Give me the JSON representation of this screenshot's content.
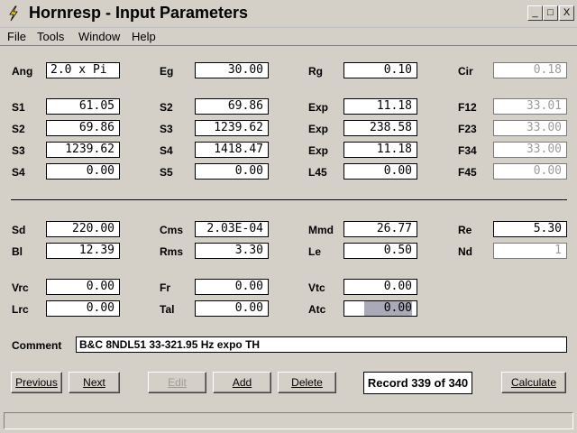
{
  "window": {
    "title": "Hornresp - Input Parameters",
    "btn_min": "_",
    "btn_max": "□",
    "btn_close": "X"
  },
  "menu": [
    "File",
    "Tools",
    "Window",
    "Help"
  ],
  "rows": [
    {
      "cells": [
        {
          "label": "Ang",
          "value": "2.0 x Pi",
          "align": "left"
        },
        {
          "label": "Eg",
          "value": "30.00"
        },
        {
          "label": "Rg",
          "value": "0.10"
        },
        {
          "label": "Cir",
          "value": "0.18",
          "dim": true
        }
      ]
    },
    {
      "cells": [
        {
          "label": "S1",
          "value": "61.05"
        },
        {
          "label": "S2",
          "value": "69.86"
        },
        {
          "label": "Exp",
          "value": "11.18"
        },
        {
          "label": "F12",
          "value": "33.01",
          "dim": true
        }
      ]
    },
    {
      "cells": [
        {
          "label": "S2",
          "value": "69.86"
        },
        {
          "label": "S3",
          "value": "1239.62"
        },
        {
          "label": "Exp",
          "value": "238.58"
        },
        {
          "label": "F23",
          "value": "33.00",
          "dim": true
        }
      ]
    },
    {
      "cells": [
        {
          "label": "S3",
          "value": "1239.62"
        },
        {
          "label": "S4",
          "value": "1418.47"
        },
        {
          "label": "Exp",
          "value": "11.18"
        },
        {
          "label": "F34",
          "value": "33.00",
          "dim": true
        }
      ]
    },
    {
      "cells": [
        {
          "label": "S4",
          "value": "0.00"
        },
        {
          "label": "S5",
          "value": "0.00"
        },
        {
          "label": "L45",
          "value": "0.00"
        },
        {
          "label": "F45",
          "value": "0.00",
          "dim": true
        }
      ]
    },
    {
      "cells": [
        {
          "label": "Sd",
          "value": "220.00"
        },
        {
          "label": "Cms",
          "value": "2.03E-04"
        },
        {
          "label": "Mmd",
          "value": "26.77"
        },
        {
          "label": "Re",
          "value": "5.30"
        }
      ]
    },
    {
      "cells": [
        {
          "label": "Bl",
          "value": "12.39"
        },
        {
          "label": "Rms",
          "value": "3.30"
        },
        {
          "label": "Le",
          "value": "0.50"
        },
        {
          "label": "Nd",
          "value": "1",
          "dim": true
        }
      ]
    },
    {
      "cells": [
        {
          "label": "Vrc",
          "value": "0.00"
        },
        {
          "label": "Fr",
          "value": "0.00"
        },
        {
          "label": "Vtc",
          "value": "0.00"
        }
      ]
    },
    {
      "cells": [
        {
          "label": "Lrc",
          "value": "0.00"
        },
        {
          "label": "Tal",
          "value": "0.00"
        },
        {
          "label": "Atc",
          "value": "0.00",
          "selected": true
        }
      ]
    }
  ],
  "comment": {
    "label": "Comment",
    "value": "B&C 8NDL51 33-321.95 Hz expo TH"
  },
  "buttons": {
    "previous": "Previous",
    "next": "Next",
    "edit": "Edit",
    "add": "Add",
    "delete": "Delete",
    "record": "Record 339 of 340",
    "calculate": "Calculate"
  },
  "status": ""
}
